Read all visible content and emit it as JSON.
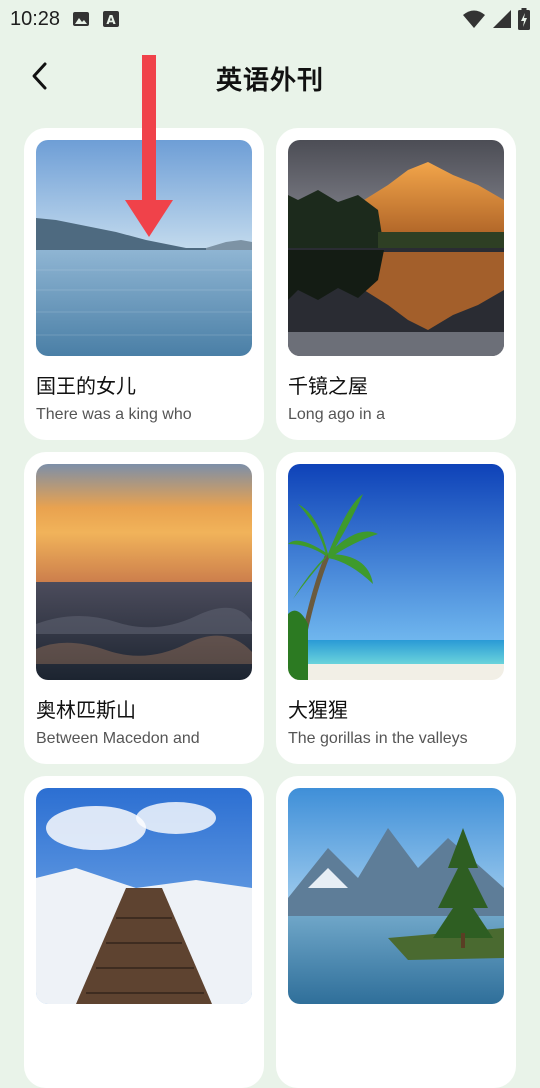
{
  "status_bar": {
    "time": "10:28",
    "icons_left": [
      "image-icon",
      "text-a-icon"
    ],
    "icons_right": [
      "wifi-icon",
      "signal-icon",
      "battery-icon"
    ]
  },
  "header": {
    "title": "英语外刊",
    "back_icon": "chevron-left-icon"
  },
  "articles": [
    {
      "title": "国王的女儿",
      "excerpt": "There was a king who",
      "image": "lake-mountain"
    },
    {
      "title": "千镜之屋",
      "excerpt": "Long ago in a",
      "image": "mountain-reflection"
    },
    {
      "title": "奥林匹斯山",
      "excerpt": "Between Macedon and",
      "image": "ocean-sunset"
    },
    {
      "title": "大猩猩",
      "excerpt": "The gorillas in the valleys",
      "image": "tropical-beach"
    },
    {
      "title": "",
      "excerpt": "",
      "image": "snowy-boardwalk"
    },
    {
      "title": "",
      "excerpt": "",
      "image": "alpine-lake-tree"
    }
  ],
  "colors": {
    "background": "#e9f3e9",
    "card": "#ffffff",
    "annotation_arrow": "#f0424a"
  }
}
